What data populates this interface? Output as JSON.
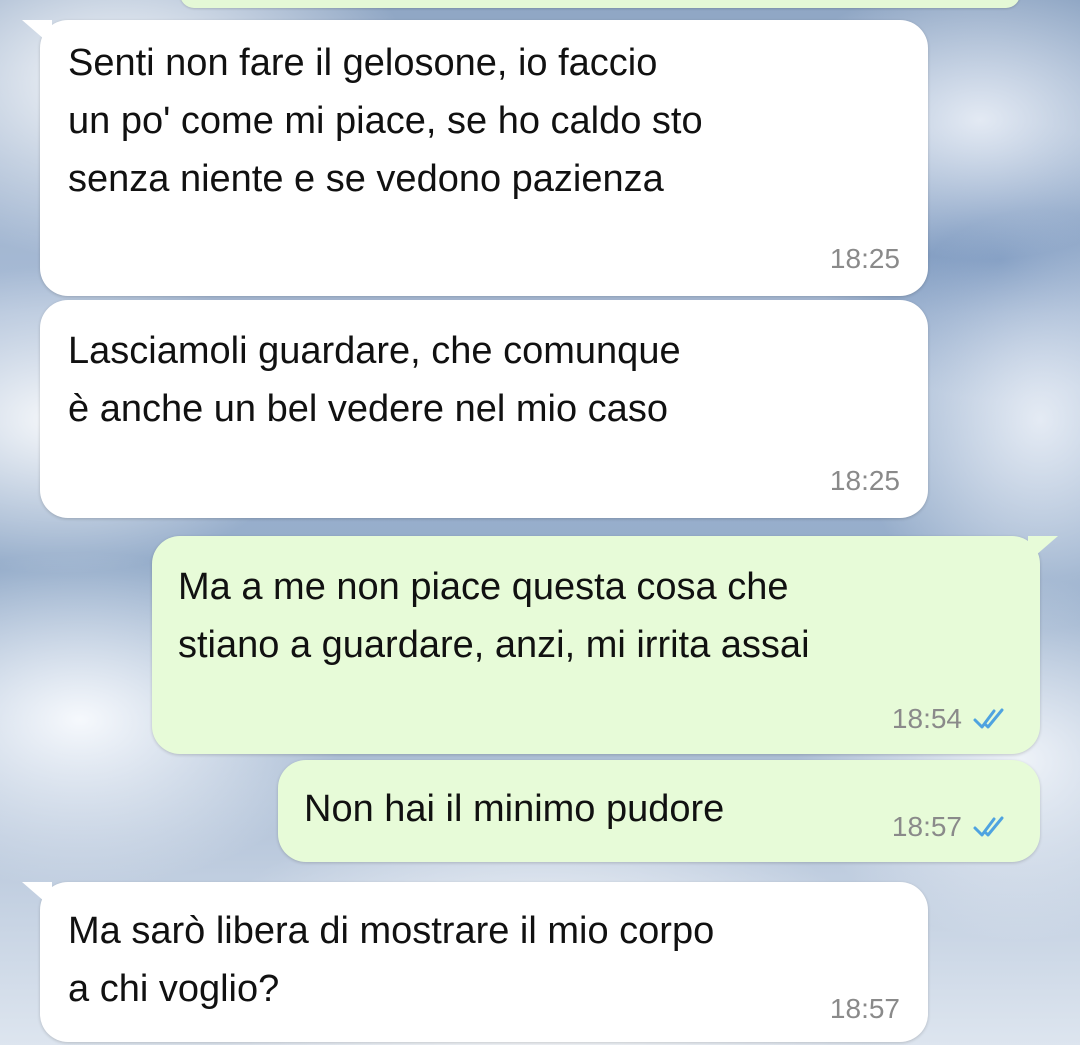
{
  "messages": [
    {
      "direction": "incoming",
      "text": "Senti non fare il gelosone, io faccio\nun po' come mi piace, se ho caldo sto\nsenza niente e se vedono pazienza",
      "time": "18:25"
    },
    {
      "direction": "incoming",
      "text": "Lasciamoli guardare, che comunque\nè anche un bel vedere nel mio caso",
      "time": "18:25"
    },
    {
      "direction": "outgoing",
      "text": "Ma a me non piace questa cosa che\nstiano a guardare, anzi, mi irrita assai",
      "time": "18:54",
      "status_icon": "double-check-read-icon"
    },
    {
      "direction": "outgoing",
      "text": "Non hai il minimo pudore",
      "time": "18:57",
      "status_icon": "double-check-read-icon"
    },
    {
      "direction": "incoming",
      "text": "Ma sarò libera di mostrare il mio corpo\na chi voglio?",
      "time": "18:57"
    }
  ],
  "colors": {
    "incoming_bubble": "#ffffff",
    "outgoing_bubble": "#e7fbd8",
    "timestamp": "#8a8a8a",
    "read_ticks": "#4fa3e0"
  }
}
